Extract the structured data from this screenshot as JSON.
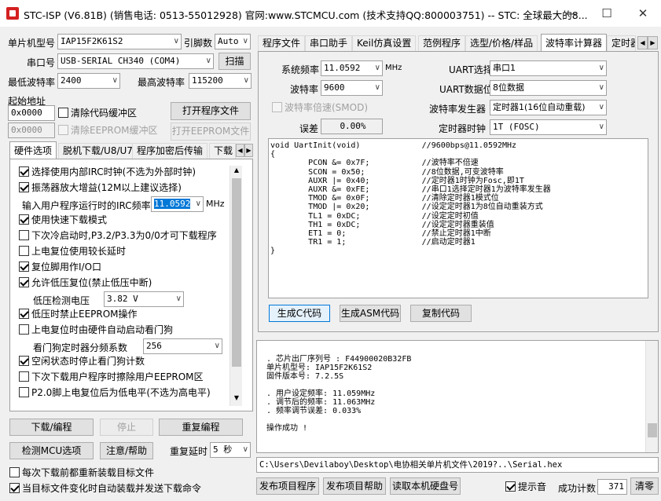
{
  "window": {
    "title": "STC-ISP (V6.81B) (销售电话: 0513-55012928) 官网:www.STCMCU.com  (技术支持QQ:800003751)  -- STC: 全球最大的8...",
    "minimize": "—",
    "maximize": "☐",
    "close": "✕"
  },
  "left": {
    "mcu_type_label": "单片机型号",
    "mcu_type_value": "IAP15F2K61S2",
    "pin_label": "引脚数",
    "pin_value": "Auto",
    "port_label": "串口号",
    "port_value": "USB-SERIAL CH340 (COM4)",
    "scan_button": "扫描",
    "min_baud_label": "最低波特率",
    "min_baud_value": "2400",
    "max_baud_label": "最高波特率",
    "max_baud_value": "115200",
    "start_addr_label": "起始地址",
    "addr1": "0x0000",
    "clear_code_buf": "清除代码缓冲区",
    "open_prog_button": "打开程序文件",
    "addr2": "0x0000",
    "clear_eeprom_buf": "清除EEPROM缓冲区",
    "open_eeprom_button": "打开EEPROM文件",
    "tabs": [
      "硬件选项",
      "脱机下载/U8/U7",
      "程序加密后传输",
      "下载"
    ],
    "hw_options": [
      {
        "label": "选择使用内部IRC时钟(不选为外部时钟)",
        "checked": true
      },
      {
        "label": "振荡器放大增益(12M以上建议选择)",
        "checked": true
      }
    ],
    "irc_freq_label": "输入用户程序运行时的IRC频率",
    "irc_freq_value": "11.0592",
    "irc_unit": "MHz",
    "hw_options2": [
      {
        "label": "使用快速下载模式",
        "checked": true
      },
      {
        "label": "下次冷启动时,P3.2/P3.3为0/0才可下载程序",
        "checked": false
      },
      {
        "label": "上电复位使用较长延时",
        "checked": false
      },
      {
        "label": "复位脚用作I/O口",
        "checked": true
      },
      {
        "label": "允许低压复位(禁止低压中断)",
        "checked": true
      }
    ],
    "low_volt_label": "低压检测电压",
    "low_volt_value": "3.82 V",
    "hw_options3": [
      {
        "label": "低压时禁止EEPROM操作",
        "checked": true
      },
      {
        "label": "上电复位时由硬件自动启动看门狗",
        "checked": false
      }
    ],
    "wdt_label": "看门狗定时器分频系数",
    "wdt_value": "256",
    "hw_options4": [
      {
        "label": "空闲状态时停止看门狗计数",
        "checked": true
      },
      {
        "label": "下次下载用户程序时擦除用户EEPROM区",
        "checked": false
      },
      {
        "label": "P2.0脚上电复位后为低电平(不选为高电平)",
        "checked": false
      }
    ],
    "download_button": "下载/编程",
    "stop_button": "停止",
    "reprogram_button": "重复编程",
    "detect_button": "检测MCU选项",
    "help_button": "注意/帮助",
    "repeat_delay_label": "重复延时",
    "repeat_delay_value": "5 秒",
    "reload_check": "每次下载前都重新装载目标文件",
    "auto_send_check": "当目标文件变化时自动装载并发送下载命令"
  },
  "right": {
    "tabs": [
      "程序文件",
      "串口助手",
      "Keil仿真设置",
      "范例程序",
      "选型/价格/样品",
      "波特率计算器",
      "定时器"
    ],
    "sys_freq_label": "系统频率",
    "sys_freq_value": "11.0592",
    "sys_freq_unit": "MHz",
    "uart_sel_label": "UART选择",
    "uart_sel_value": "串口1",
    "baud_label": "波特率",
    "baud_value": "9600",
    "uart_data_label": "UART数据位",
    "uart_data_value": "8位数据",
    "double_label": "波特率倍速(SMOD)",
    "gen_label": "波特率发生器",
    "gen_value": "定时器1(16位自动重载)",
    "error_label": "误差",
    "error_value": "0.00%",
    "clock_label": "定时器时钟",
    "clock_value": "1T  (FOSC)",
    "code": "void UartInit(void)\t\t//9600bps@11.0592MHz\n{\n\tPCON &= 0x7F;\t\t//波特率不倍速\n\tSCON = 0x50;\t\t//8位数据,可变波特率\n\tAUXR |= 0x40;\t\t//定时器1时钟为Fosc,即1T\n\tAUXR &= 0xFE;\t\t//串口1选择定时器1为波特率发生器\n\tTMOD &= 0x0F;\t\t//清除定时器1模式位\n\tTMOD |= 0x20;\t\t//设定定时器1为8位自动重装方式\n\tTL1 = 0xDC;\t\t//设定定时初值\n\tTH1 = 0xDC;\t\t//设定定时器重装值\n\tET1 = 0;\t\t//禁止定时器1中断\n\tTR1 = 1;\t\t//启动定时器1\n}",
    "gen_c_button": "生成C代码",
    "gen_asm_button": "生成ASM代码",
    "copy_button": "复制代码",
    "log": ". 芯片出厂序列号 : F44900020B32FB\n单片机型号: IAP15F2K61S2\n固件版本号: 7.2.5S\n\n. 用户设定频率: 11.059MHz\n. 调节后的频率: 11.063MHz\n. 频率调节误差: 0.033%\n\n操作成功 !",
    "file_path": "C:\\Users\\Devilaboy\\Desktop\\电协相关单片机文件\\2019?..\\Serial.hex",
    "publish_button": "发布项目程序",
    "publish_help_button": "发布项目帮助",
    "read_id_button": "读取本机硬盘号",
    "tip_sound_label": "提示音",
    "success_count_label": "成功计数",
    "success_count_value": "371",
    "clear_button": "清零"
  }
}
